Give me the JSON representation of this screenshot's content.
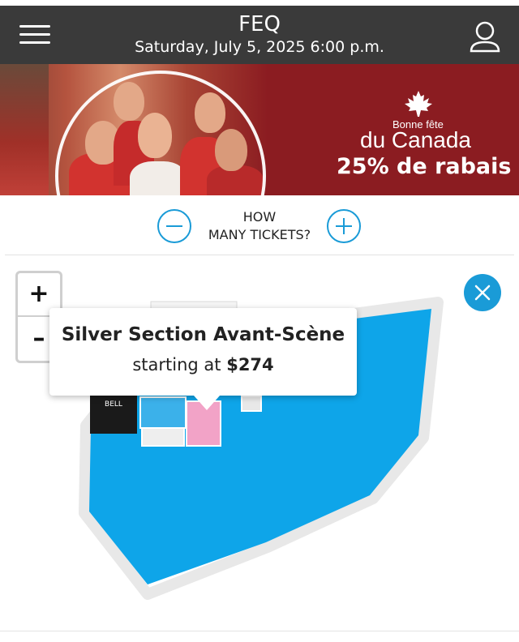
{
  "header": {
    "title": "FEQ",
    "datetime": "Saturday, July 5, 2025 6:00 p.m.",
    "menu_icon": "hamburger-menu-icon",
    "user_icon": "user-account-icon"
  },
  "banner": {
    "line1": "Bonne fête",
    "line2": "du Canada",
    "line3": "25% de rabais",
    "icon": "maple-leaf-icon",
    "background_color": "#8b1c21"
  },
  "ticket_quantity": {
    "label_line1": "HOW",
    "label_line2": "MANY TICKETS?",
    "decrease_icon": "minus-circle-icon",
    "increase_icon": "plus-circle-icon",
    "accent_color": "#1a9bd7"
  },
  "map": {
    "zoom_in_label": "+",
    "zoom_out_label": "–",
    "close_icon": "close-icon",
    "venue_color": "#0ea5e9",
    "sections": [
      {
        "label": "BELL"
      },
      {
        "label": ""
      },
      {
        "label": ""
      },
      {
        "label": ""
      }
    ],
    "tooltip": {
      "title": "Silver Section Avant-Scène",
      "price_prefix": "starting at",
      "price": "$274"
    }
  }
}
